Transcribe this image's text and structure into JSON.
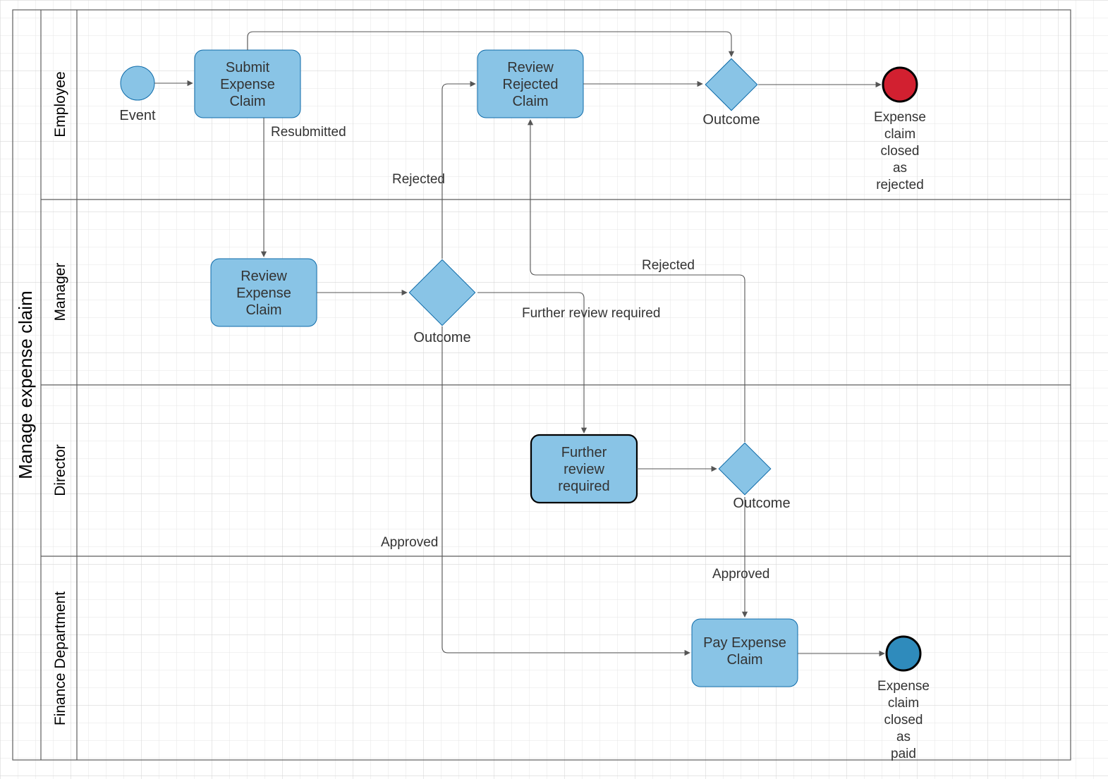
{
  "pool": {
    "title": "Manage expense claim"
  },
  "lanes": {
    "employee": "Employee",
    "manager": "Manager",
    "director": "Director",
    "finance": "Finance Department"
  },
  "events": {
    "start": {
      "label": "Event"
    },
    "endRej": {
      "line1": "Expense",
      "line2": "claim",
      "line3": "closed",
      "line4": "as",
      "line5": "rejected"
    },
    "endPaid": {
      "line1": "Expense",
      "line2": "claim",
      "line3": "closed",
      "line4": "as",
      "line5": "paid"
    }
  },
  "tasks": {
    "submit": {
      "line1": "Submit",
      "line2": "Expense",
      "line3": "Claim"
    },
    "reviewRej": {
      "line1": "Review",
      "line2": "Rejected",
      "line3": "Claim"
    },
    "reviewExp": {
      "line1": "Review",
      "line2": "Expense",
      "line3": "Claim"
    },
    "further": {
      "line1": "Further",
      "line2": "review",
      "line3": "required"
    },
    "pay": {
      "line1": "Pay Expense",
      "line2": "Claim"
    }
  },
  "gateways": {
    "empOutcome": "Outcome",
    "mgrOutcome": "Outcome",
    "dirOutcome": "Outcome"
  },
  "edgeLabels": {
    "resubmitted": "Resubmitted",
    "rejected1": "Rejected",
    "furtherReview": "Further review required",
    "approved1": "Approved",
    "rejected2": "Rejected",
    "approved2": "Approved"
  }
}
